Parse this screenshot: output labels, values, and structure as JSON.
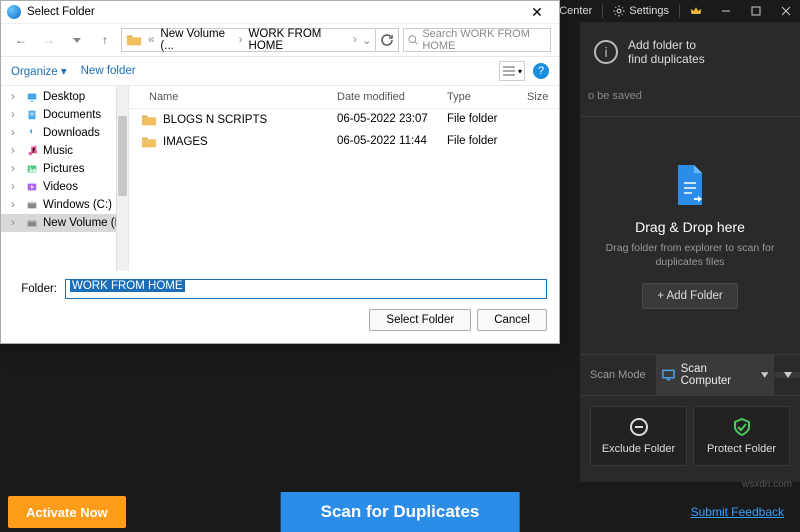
{
  "topbar": {
    "action_center": "Action Center",
    "settings": "Settings"
  },
  "right_panel": {
    "add_folder_hint_l1": "Add folder to",
    "add_folder_hint_l2": "find duplicates",
    "be_saved": "o be saved",
    "drop_title": "Drag & Drop here",
    "drop_sub": "Drag folder from explorer to scan for duplicates files",
    "add_folder_btn": "+ Add Folder",
    "scan_mode_label": "Scan Mode",
    "scan_mode_value": "Scan Computer",
    "exclude_folder": "Exclude Folder",
    "protect_folder": "Protect Folder"
  },
  "bottom": {
    "activate": "Activate Now",
    "scan": "Scan for Duplicates",
    "feedback": "Submit Feedback",
    "watermark": "wsxdn.com"
  },
  "dialog": {
    "title": "Select Folder",
    "breadcrumb": {
      "seg1": "New Volume (...",
      "seg2": "WORK FROM HOME"
    },
    "search_placeholder": "Search WORK FROM HOME",
    "organize": "Organize",
    "new_folder": "New folder",
    "columns": {
      "name": "Name",
      "date": "Date modified",
      "type": "Type",
      "size": "Size"
    },
    "sidebar": [
      {
        "label": "Desktop"
      },
      {
        "label": "Documents"
      },
      {
        "label": "Downloads"
      },
      {
        "label": "Music"
      },
      {
        "label": "Pictures"
      },
      {
        "label": "Videos"
      },
      {
        "label": "Windows (C:)"
      },
      {
        "label": "New Volume (D",
        "selected": true
      }
    ],
    "rows": [
      {
        "name": "BLOGS N SCRIPTS",
        "date": "06-05-2022 23:07",
        "type": "File folder"
      },
      {
        "name": "IMAGES",
        "date": "06-05-2022 11:44",
        "type": "File folder"
      }
    ],
    "folder_label": "Folder:",
    "folder_value": "WORK FROM HOME",
    "select_btn": "Select Folder",
    "cancel_btn": "Cancel"
  }
}
